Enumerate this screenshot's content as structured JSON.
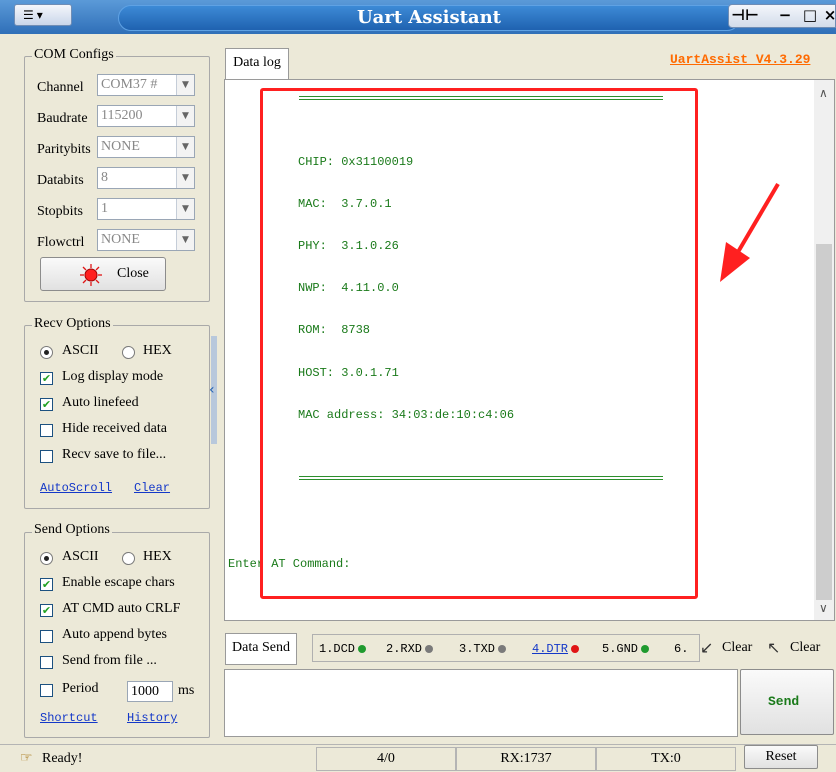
{
  "window": {
    "title": "Uart Assistant",
    "version_link": "UartAssist V4.3.29",
    "controls": {
      "pin": "⊣⊢",
      "minimize": "−",
      "maximize": "□",
      "close": "×"
    }
  },
  "com_configs": {
    "title": "COM Configs",
    "fields": [
      {
        "label": "Channel",
        "value": "COM37 #"
      },
      {
        "label": "Baudrate",
        "value": "115200"
      },
      {
        "label": "Paritybits",
        "value": "NONE"
      },
      {
        "label": "Databits",
        "value": "8"
      },
      {
        "label": "Stopbits",
        "value": "1"
      },
      {
        "label": "Flowctrl",
        "value": "NONE"
      }
    ],
    "close_button": "Close"
  },
  "recv_options": {
    "title": "Recv Options",
    "ascii": "ASCII",
    "hex": "HEX",
    "selected": "ASCII",
    "checks": [
      {
        "label": "Log display mode",
        "checked": true
      },
      {
        "label": "Auto linefeed",
        "checked": true
      },
      {
        "label": "Hide received data",
        "checked": false
      },
      {
        "label": "Recv save to file...",
        "checked": false
      }
    ],
    "autoscroll": "AutoScroll",
    "clear": "Clear"
  },
  "send_options": {
    "title": "Send Options",
    "ascii": "ASCII",
    "hex": "HEX",
    "selected": "ASCII",
    "checks": [
      {
        "label": "Enable escape chars",
        "checked": true
      },
      {
        "label": "AT CMD auto CRLF",
        "checked": true
      },
      {
        "label": "Auto append bytes",
        "checked": false
      },
      {
        "label": "Send from file ...",
        "checked": false
      }
    ],
    "period_label": "Period",
    "period_checked": false,
    "period_value": "1000",
    "period_unit": "ms",
    "shortcut": "Shortcut",
    "history": "History"
  },
  "data_log": {
    "tab": "Data log",
    "lines": [
      "CHIP: 0x31100019",
      "MAC:  3.7.0.1",
      "PHY:  3.1.0.26",
      "NWP:  4.11.0.0",
      "ROM:  8738",
      "HOST: 3.0.1.71",
      "MAC address: 34:03:de:10:c4:06"
    ],
    "prompt": "Enter AT Command:"
  },
  "data_send": {
    "tab": "Data Send",
    "pins": [
      {
        "label": "1.DCD",
        "color": "#1f9a2e",
        "link": false
      },
      {
        "label": "2.RXD",
        "color": "#7a7a7a",
        "link": false
      },
      {
        "label": "3.TXD",
        "color": "#7a7a7a",
        "link": false
      },
      {
        "label": "4.DTR",
        "color": "#e01515",
        "link": true
      },
      {
        "label": "5.GND",
        "color": "#1f9a2e",
        "link": false
      },
      {
        "label": "6.",
        "color": "",
        "link": false
      }
    ],
    "clear1": "Clear",
    "clear2": "Clear",
    "send": "Send"
  },
  "status": {
    "ready": "Ready!",
    "counter": "4/0",
    "rx": "RX:1737",
    "tx": "TX:0",
    "reset": "Reset"
  },
  "colors": {
    "log_text": "#1a7a1a",
    "annotation": "#ff2020",
    "version_link": "#ff6a00"
  },
  "icons": [
    "menu-icon",
    "pin-icon",
    "minimize-icon",
    "maximize-icon",
    "close-icon",
    "port-status-icon",
    "collapse-arrow-icon",
    "clear-arrow-icon",
    "ready-icon",
    "annotation-arrow"
  ]
}
